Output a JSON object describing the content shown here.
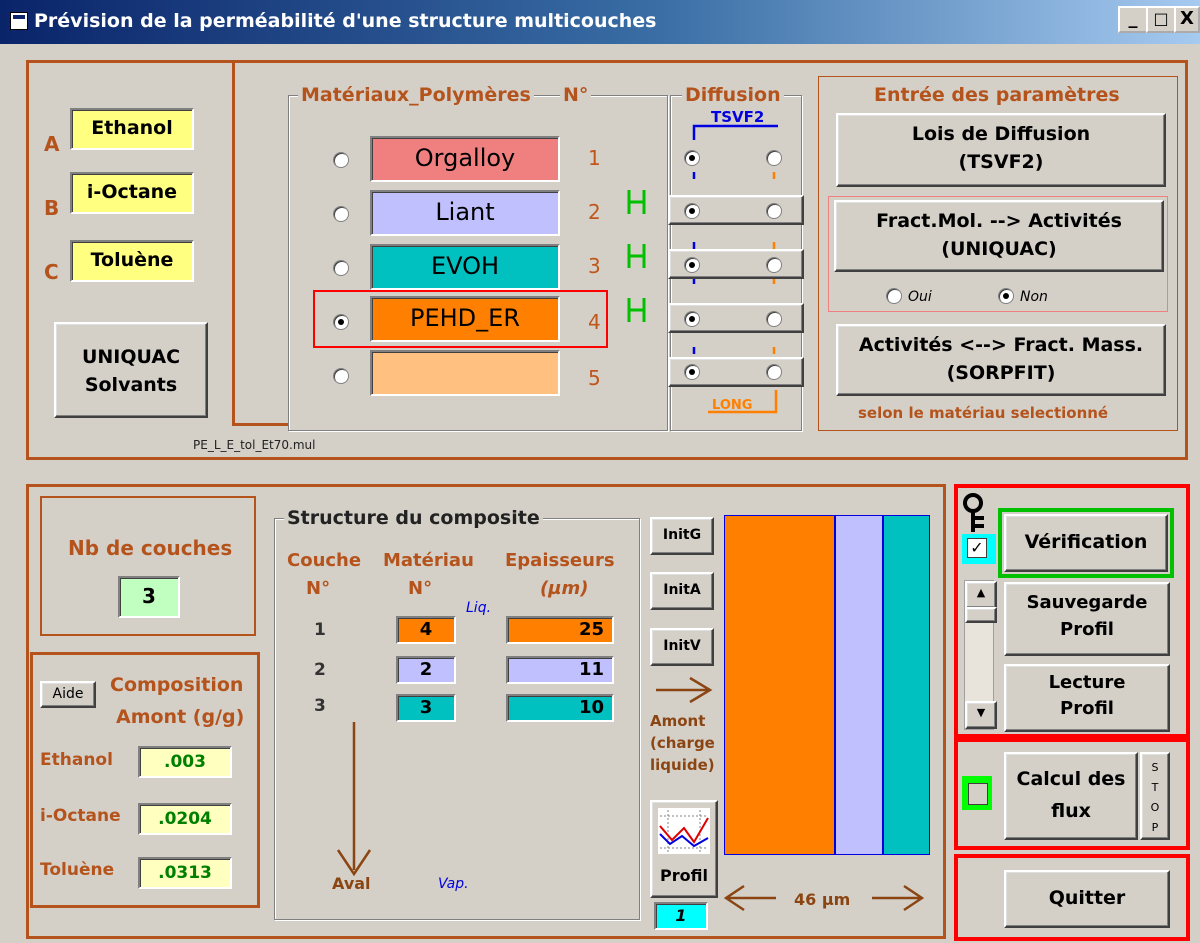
{
  "window": {
    "title": "Prévision de la perméabilité d'une structure multicouches",
    "min": "_",
    "max": "□",
    "close": "X"
  },
  "solvents": [
    {
      "letter": "A",
      "name": "Ethanol"
    },
    {
      "letter": "B",
      "name": "i-Octane"
    },
    {
      "letter": "C",
      "name": "Toluène"
    }
  ],
  "uniquac_solvants": {
    "line1": "UNIQUAC",
    "line2": "Solvants"
  },
  "materials": {
    "legend": "Matériaux_Polymères",
    "no_label": "N°",
    "items": [
      {
        "name": "Orgalloy",
        "no": "1",
        "color": "#f08080"
      },
      {
        "name": "Liant",
        "no": "2",
        "color": "#c0c0ff"
      },
      {
        "name": "EVOH",
        "no": "3",
        "color": "#00c0c0"
      },
      {
        "name": "PEHD_ER",
        "no": "4",
        "color": "#ff8000"
      },
      {
        "name": "",
        "no": "5",
        "color": "#ffc080"
      }
    ],
    "selected": "4",
    "file": "PE_L_E_tol_Et70.mul"
  },
  "diffusion": {
    "legend": "Diffusion",
    "tsvf2": "TSVF2",
    "long": "LONG"
  },
  "params": {
    "legend": "Entrée des paramètres",
    "lois": "Lois de Diffusion",
    "lois2": "(TSVF2)",
    "fract": "Fract.Mol.   --> Activités",
    "fract2": "(UNIQUAC)",
    "oui": "Oui",
    "non": "Non",
    "act": "Activités <--> Fract. Mass.",
    "act2": "(SORPFIT)",
    "note": "selon le matériau selectionné"
  },
  "nb_couches": {
    "label": "Nb de couches",
    "value": "3"
  },
  "composition": {
    "aide": "Aide",
    "title1": "Composition",
    "title2": "Amont (g/g)",
    "rows": [
      {
        "name": "Ethanol",
        "value": ".003"
      },
      {
        "name": "i-Octane",
        "value": ".0204"
      },
      {
        "name": "Toluène",
        "value": ".0313"
      }
    ]
  },
  "structure": {
    "legend": "Structure du composite",
    "h_couche": "Couche",
    "h_couche2": "N°",
    "h_mat": "Matériau",
    "h_mat2": "N°",
    "h_ep": "Epaisseurs",
    "h_ep2": "(µm)",
    "liq": "Liq.",
    "vap": "Vap.",
    "aval": "Aval",
    "layers": [
      {
        "n": "1",
        "mat": "4",
        "ep": "25",
        "color": "#ff8000"
      },
      {
        "n": "2",
        "mat": "2",
        "ep": "11",
        "color": "#c0c0ff"
      },
      {
        "n": "3",
        "mat": "3",
        "ep": "10",
        "color": "#00c0c0"
      }
    ]
  },
  "init": {
    "g": "InitG",
    "a": "InitA",
    "v": "InitV"
  },
  "amont": {
    "l1": "Amont",
    "l2": "(charge",
    "l3": "liquide)"
  },
  "profil": {
    "label": "Profil",
    "value": "1"
  },
  "total": "46 µm",
  "right": {
    "verification": "Vérification",
    "sauvegarde1": "Sauvegarde",
    "sauvegarde2": "Profil",
    "lecture1": "Lecture",
    "lecture2": "Profil",
    "calcul1": "Calcul des",
    "calcul2": "flux",
    "stop": [
      "S",
      "T",
      "O",
      "P"
    ],
    "quitter": "Quitter"
  },
  "colors": {
    "accent": "#b5531c",
    "red": "#ff0000",
    "green": "#00c000",
    "cyan": "#00ffff"
  }
}
